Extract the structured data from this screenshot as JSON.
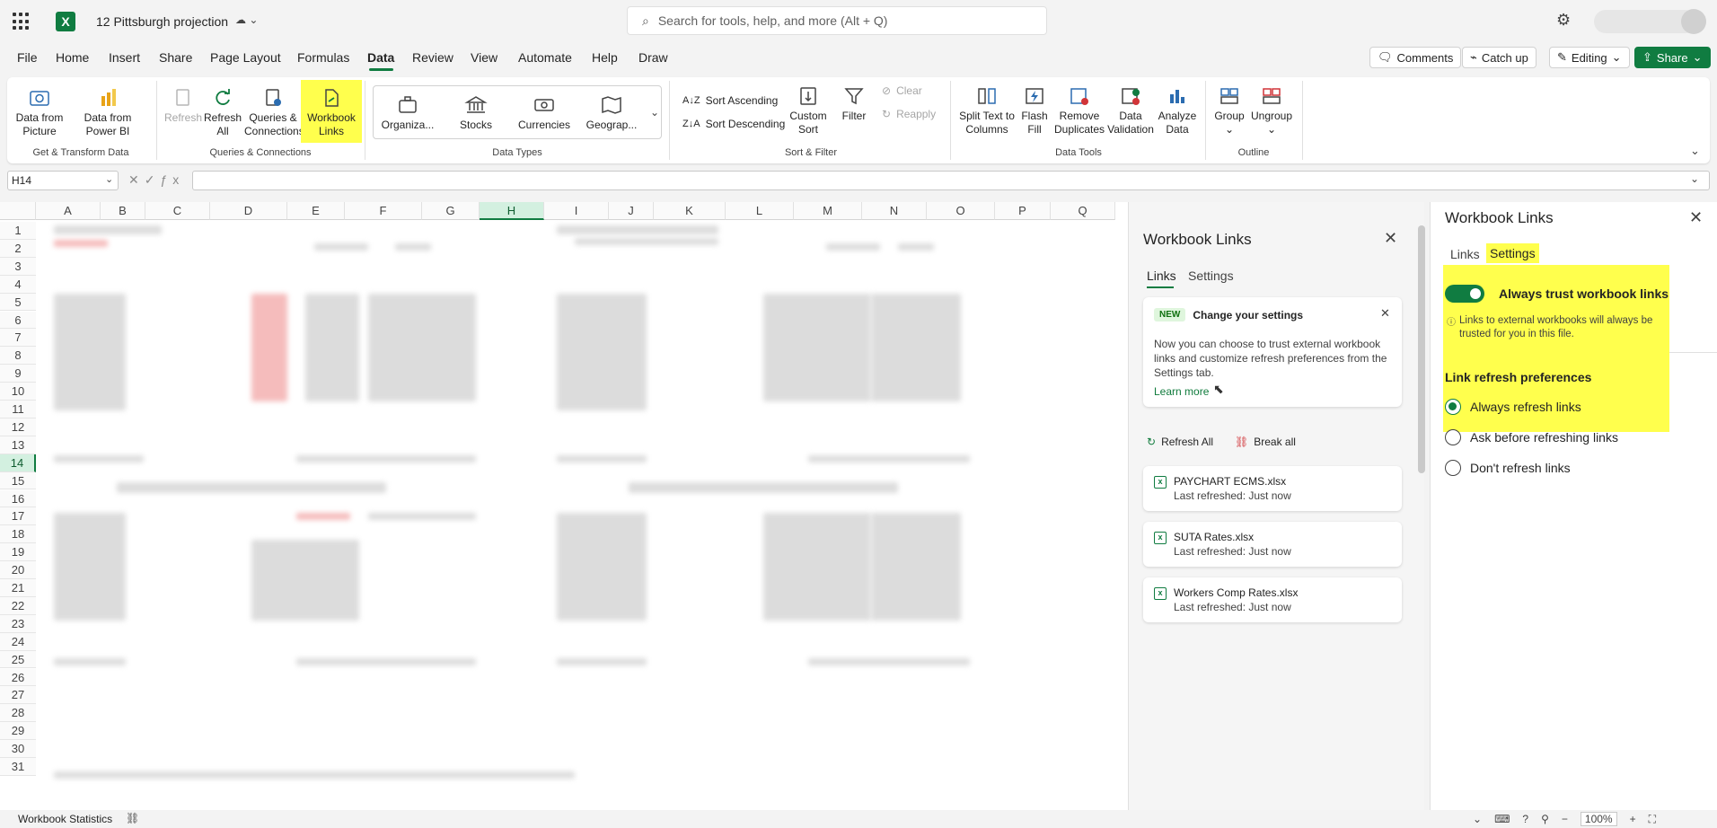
{
  "titlebar": {
    "doc_title": "12 Pittsburgh projection",
    "search_placeholder": "Search for tools, help, and more (Alt + Q)"
  },
  "menu": {
    "items": [
      "File",
      "Home",
      "Insert",
      "Share",
      "Page Layout",
      "Formulas",
      "Data",
      "Review",
      "View",
      "Automate",
      "Help",
      "Draw"
    ],
    "active": "Data",
    "comments": "Comments",
    "catch_up": "Catch up",
    "editing": "Editing",
    "share": "Share"
  },
  "ribbon": {
    "data_from_picture": "Data from Picture",
    "data_from_power_bi": "Data from Power BI",
    "group_get_transform": "Get & Transform Data",
    "refresh": "Refresh",
    "refresh_all": "Refresh All",
    "queries_connections": "Queries & Connections",
    "workbook_links": "Workbook Links",
    "group_queries": "Queries & Connections",
    "organiza": "Organiza...",
    "stocks": "Stocks",
    "currencies": "Currencies",
    "geograp": "Geograp...",
    "group_data_types": "Data Types",
    "sort_ascending": "Sort Ascending",
    "sort_descending": "Sort Descending",
    "custom_sort": "Custom Sort",
    "filter": "Filter",
    "clear": "Clear",
    "reapply": "Reapply",
    "group_sort_filter": "Sort & Filter",
    "split_text": "Split Text to Columns",
    "flash_fill": "Flash Fill",
    "remove_duplicates": "Remove Duplicates",
    "data_validation": "Data Validation",
    "analyze_data": "Analyze Data",
    "group_data_tools": "Data Tools",
    "group": "Group",
    "ungroup": "Ungroup",
    "group_outline": "Outline"
  },
  "formula_bar": {
    "name_box": "H14",
    "formula": ""
  },
  "grid": {
    "columns": [
      "A",
      "B",
      "C",
      "D",
      "E",
      "F",
      "G",
      "H",
      "I",
      "J",
      "K",
      "L",
      "M",
      "N",
      "O",
      "P",
      "Q"
    ],
    "rows": [
      "1",
      "2",
      "3",
      "4",
      "5",
      "6",
      "7",
      "8",
      "9",
      "10",
      "11",
      "12",
      "13",
      "14",
      "15",
      "16",
      "17",
      "18",
      "19",
      "20",
      "21",
      "22",
      "23",
      "24",
      "25",
      "26",
      "27",
      "28",
      "29",
      "30",
      "31"
    ],
    "selected_column": "H",
    "selected_row": "14"
  },
  "status": {
    "workbook_statistics": "Workbook Statistics",
    "zoom": "100%"
  },
  "links_panel": {
    "title": "Workbook Links",
    "tab_links": "Links",
    "tab_settings": "Settings",
    "notice_badge": "NEW",
    "notice_title": "Change your settings",
    "notice_body": "Now you can choose to trust external workbook links and customize refresh preferences from the Settings tab.",
    "learn_more": "Learn more",
    "refresh_all": "Refresh All",
    "break_all": "Break all",
    "files": [
      {
        "name": "PAYCHART ECMS.xlsx",
        "status": "Last refreshed: Just now"
      },
      {
        "name": "SUTA Rates.xlsx",
        "status": "Last refreshed: Just now"
      },
      {
        "name": "Workers Comp Rates.xlsx",
        "status": "Last refreshed: Just now"
      }
    ]
  },
  "settings_panel": {
    "title": "Workbook Links",
    "tab_links": "Links",
    "tab_settings": "Settings",
    "toggle_label": "Always trust workbook links",
    "toggle_on": true,
    "info_text": "Links to external workbooks will always be trusted for you in this file.",
    "refresh_heading": "Link refresh preferences",
    "options": [
      "Always refresh links",
      "Ask before refreshing links",
      "Don't refresh links"
    ],
    "selected_option": 0
  },
  "colors": {
    "accent": "#107c41",
    "highlight": "#ffff4d"
  }
}
